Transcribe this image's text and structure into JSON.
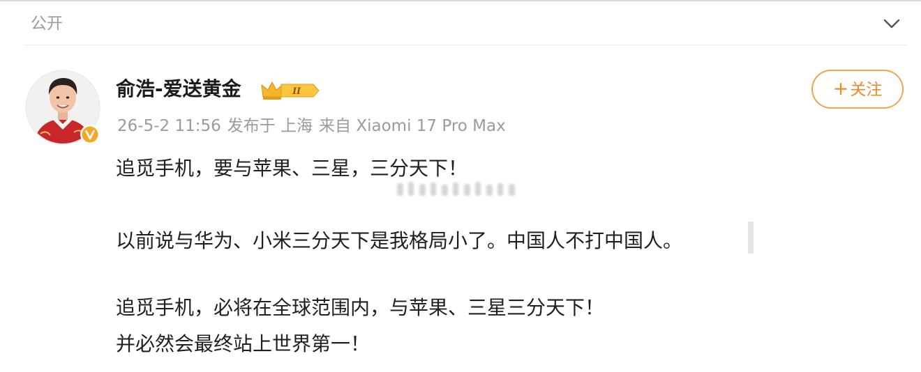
{
  "visibility": {
    "label": "公开",
    "chevron_icon": "chevron-down-icon"
  },
  "post": {
    "author": {
      "name": "俞浩-爱送黄金",
      "avatar_icon": "avatar",
      "verified_icon": "verified-v-icon",
      "vip_badge_icon": "crown-vip-badge-icon",
      "vip_level": "II"
    },
    "meta": {
      "datetime": "26-5-2 11:56",
      "location": "发布于 上海",
      "source": "来自 Xiaomi 17 Pro Max"
    },
    "follow": {
      "plus": "+",
      "label": "关注"
    },
    "paragraphs": [
      "追觅手机，要与苹果、三星，三分天下！",
      "以前说与华为、小米三分天下是我格局小了。中国人不打中国人。",
      "追觅手机，必将在全球范围内，与苹果、三星三分天下！",
      "并必然会最终站上世界第一！"
    ]
  },
  "colors": {
    "accent_orange": "#f0a54a",
    "follow_text": "#ea8b2b",
    "meta_gray": "#9b9b9b",
    "verified_gold": "#f5a623"
  }
}
